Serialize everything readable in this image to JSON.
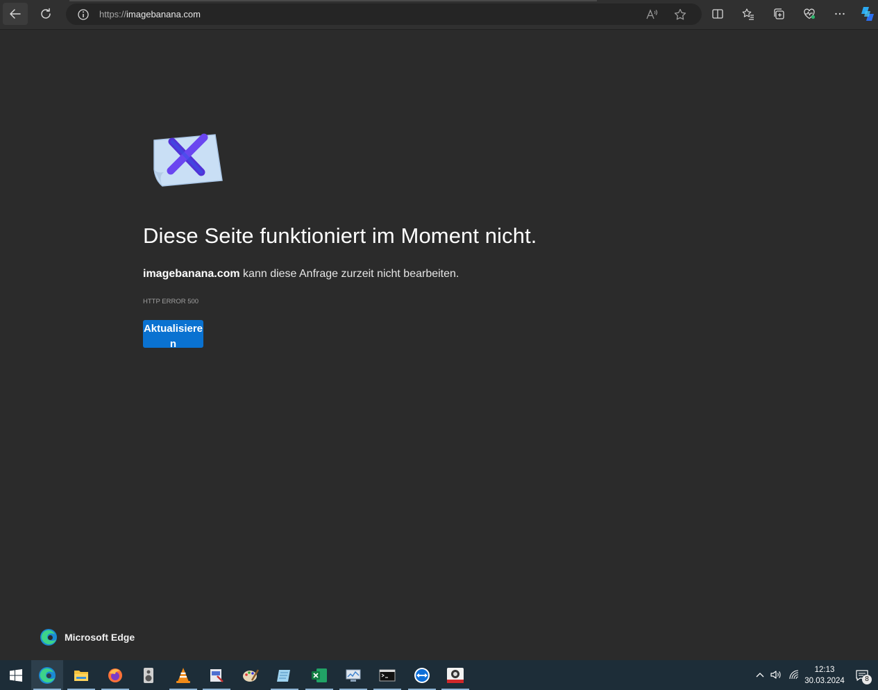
{
  "browser": {
    "url_scheme": "https://",
    "url_host": "imagebanana.com"
  },
  "error": {
    "title": "Diese Seite funktioniert im Moment nicht.",
    "host": "imagebanana.com",
    "description_rest": " kann diese Anfrage zurzeit nicht bearbeiten.",
    "code": "HTTP ERROR 500",
    "reload_label": "Aktualisieren"
  },
  "brand": {
    "label": "Microsoft Edge"
  },
  "taskbar": {
    "apps": [
      "edge",
      "file-explorer",
      "firefox",
      "speaker-app",
      "vlc",
      "screen-capture",
      "paint",
      "notepad-app",
      "excel",
      "task-monitor",
      "terminal",
      "teamviewer",
      "photo-tool"
    ],
    "time": "12:13",
    "date": "30.03.2024",
    "notification_count": "8"
  }
}
